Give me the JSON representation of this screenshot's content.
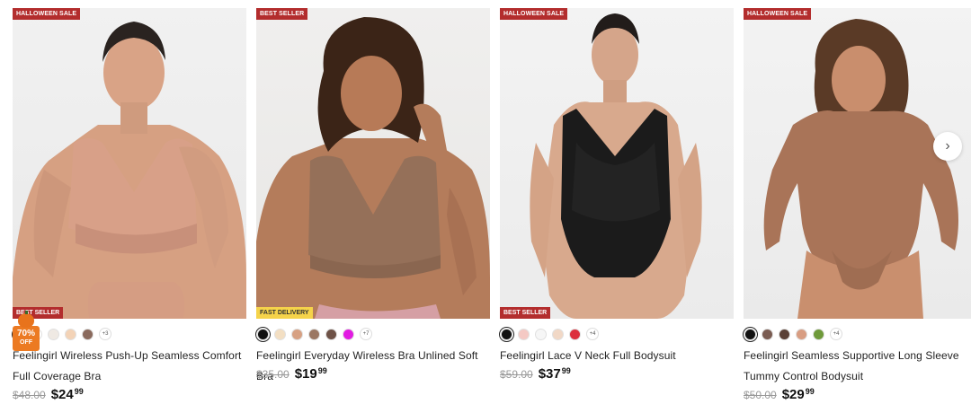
{
  "products": [
    {
      "top_badge": "HALLOWEEN SALE",
      "bottom_badge": "BEST SELLER",
      "bottom_badge_style": "red",
      "promo": {
        "percent": "70%",
        "label": "OFF"
      },
      "swatches": [
        "#1a1a1a",
        "#ffffff",
        "#efe9e3",
        "#f3d3b7",
        "#8a6a5d"
      ],
      "more_colors": "+3",
      "title": "Feelingirl Wireless Push-Up Seamless Comfort Full Coverage Bra",
      "old_price": "$48.00",
      "price_main": "$24",
      "price_cents": "99",
      "image": "model-nude-bra"
    },
    {
      "top_badge": "BEST SELLER",
      "bottom_badge": "FAST DELIVERY",
      "bottom_badge_style": "yellow",
      "swatches": [
        "#111111",
        "#f3dfc3",
        "#d7a183",
        "#9b7763",
        "#6e5247",
        "#e21be2"
      ],
      "more_colors": "+7",
      "title": "Feelingirl Everyday Wireless Bra Unlined Soft Bra",
      "old_price": "$35.00",
      "price_main": "$19",
      "price_cents": "99",
      "image": "model-taupe-bra"
    },
    {
      "top_badge": "HALLOWEEN SALE",
      "bottom_badge": "BEST SELLER",
      "bottom_badge_style": "red",
      "swatches": [
        "#111111",
        "#f4c9c4",
        "#f6f6f6",
        "#f1d8c6",
        "#dc2f3c"
      ],
      "more_colors": "+4",
      "title": "Feelingirl Lace V Neck Full Bodysuit",
      "old_price": "$59.00",
      "price_main": "$37",
      "price_cents": "99",
      "image": "model-black-lace-bodysuit"
    },
    {
      "top_badge": "HALLOWEEN SALE",
      "swatches": [
        "#111111",
        "#7a5c52",
        "#5a4036",
        "#d89d82",
        "#6f9a3a"
      ],
      "more_colors": "+4",
      "title": "Feelingirl Seamless Supportive Long Sleeve Tummy Control Bodysuit",
      "old_price": "$50.00",
      "price_main": "$29",
      "price_cents": "99",
      "image": "model-brown-long-sleeve-bodysuit"
    }
  ],
  "carousel": {
    "next_icon": "chevron-right-icon",
    "next_glyph": "›"
  }
}
